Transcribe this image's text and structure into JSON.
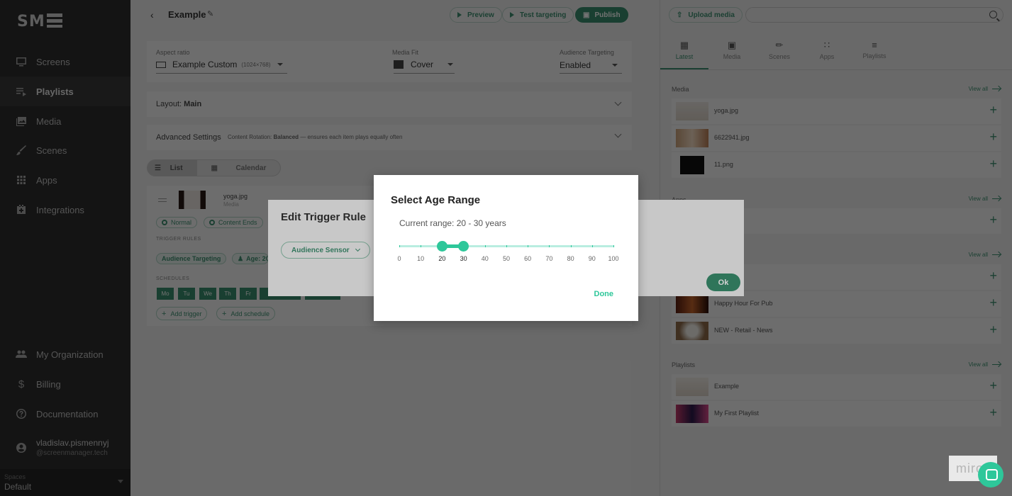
{
  "sidebar": {
    "logo": "SM",
    "items": [
      {
        "label": "Screens",
        "icon": "monitor-icon"
      },
      {
        "label": "Playlists",
        "icon": "playlist-icon"
      },
      {
        "label": "Media",
        "icon": "media-icon"
      },
      {
        "label": "Scenes",
        "icon": "brush-icon"
      },
      {
        "label": "Apps",
        "icon": "grid-icon"
      },
      {
        "label": "Integrations",
        "icon": "integrations-icon"
      }
    ],
    "bottom_items": [
      {
        "label": "My Organization",
        "icon": "people-icon"
      },
      {
        "label": "Billing",
        "icon": "dollar-icon"
      },
      {
        "label": "Documentation",
        "icon": "help-icon"
      }
    ],
    "user": {
      "name": "vladislav.pismennyj",
      "email": "@screenmanager.tech"
    },
    "spaces": {
      "label": "Spaces",
      "value": "Default"
    }
  },
  "topbar": {
    "title": "Example",
    "preview": "Preview",
    "test_targeting": "Test targeting",
    "publish": "Publish"
  },
  "settings": {
    "aspect_label": "Aspect ratio",
    "aspect_value": "Example Custom",
    "aspect_size": "(1024×768)",
    "fit_label": "Media Fit",
    "fit_value": "Cover",
    "audience_label": "Audience Targeting",
    "audience_value": "Enabled"
  },
  "layout": {
    "label": "Layout:",
    "value": "Main"
  },
  "advanced": {
    "label": "Advanced Settings",
    "rotation_label": "Content Rotation:",
    "rotation_value": "Balanced",
    "rotation_desc": "— ensures each item plays equally often"
  },
  "view_toggle": {
    "list": "List",
    "calendar": "Calendar"
  },
  "item": {
    "name": "yoga.jpg",
    "type": "Media",
    "tag_normal": "Normal",
    "tag_content_ends": "Content Ends",
    "trigger_rules_caption": "TRIGGER RULES",
    "trigger_tag": "Audience Targeting",
    "age_tag": "Age: 20",
    "schedules_caption": "SCHEDULES",
    "days": [
      "Mo",
      "Tu",
      "We",
      "Th",
      "Fr"
    ],
    "add_trigger": "Add trigger",
    "add_schedule": "Add schedule"
  },
  "right": {
    "upload": "Upload media",
    "tabs": [
      "Latest",
      "Media",
      "Scenes",
      "Apps",
      "Playlists"
    ],
    "media_title": "Media",
    "apps_title": "Apps",
    "playlists_title": "Playlists",
    "view_all": "View all",
    "media": [
      "yoga.jpg",
      "6622941.jpg",
      "11.png"
    ],
    "scenes": [
      "Happy Hour For Pub",
      "NEW - Retail - News"
    ],
    "playlists": [
      "Example",
      "My First Playlist"
    ]
  },
  "trigger_dialog": {
    "title": "Edit Trigger Rule",
    "sensor": "Audience Sensor",
    "ok": "Ok"
  },
  "age_dialog": {
    "title": "Select Age Range",
    "current": "Current range: 20 - 30 years",
    "min": 20,
    "max": 30,
    "ticks": [
      "0",
      "10",
      "20",
      "30",
      "40",
      "50",
      "60",
      "70",
      "80",
      "90",
      "100"
    ],
    "done": "Done"
  },
  "widget": {
    "miro": "miro"
  },
  "colors": {
    "accent": "#2ec79a",
    "accent_dark": "#3a8f6e",
    "sidebar": "#2f2f2f"
  }
}
